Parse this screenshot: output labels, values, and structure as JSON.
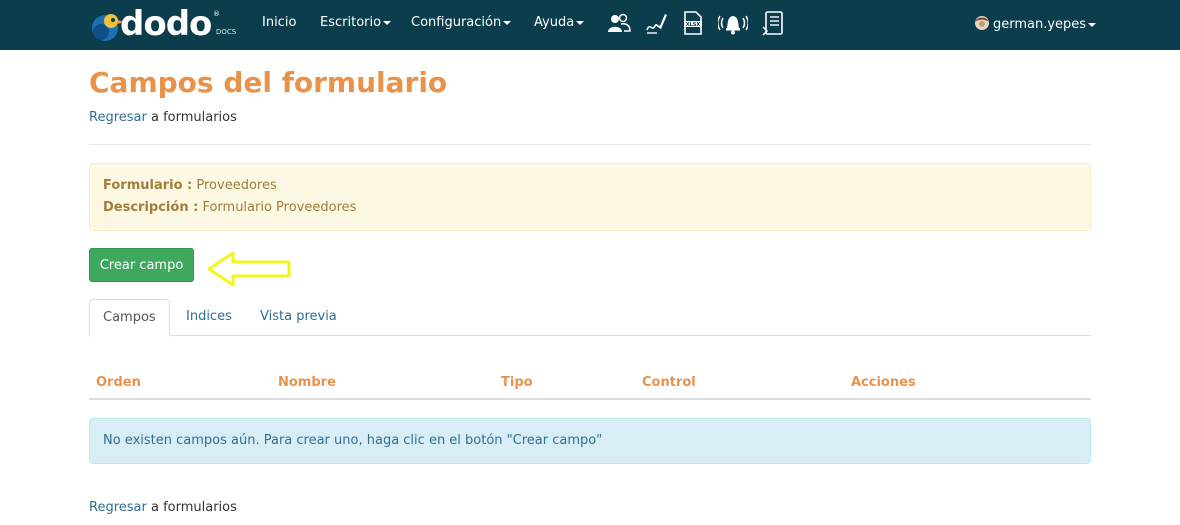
{
  "navbar": {
    "brand": "dodo",
    "brand_sub": "DOCS",
    "brand_reg": "®",
    "items": [
      {
        "label": "Inicio"
      },
      {
        "label": "Escritorio"
      },
      {
        "label": "Configuración"
      },
      {
        "label": "Ayuda"
      }
    ],
    "icons": [
      "users-icon",
      "signature-icon",
      "xlsx-file-icon",
      "alarm-bell-icon",
      "document-list-icon"
    ],
    "user": "german.yepes",
    "bg_color": "#0b3d4c"
  },
  "page": {
    "title": "Campos del formulario",
    "back_link": "Regresar",
    "back_suffix": " a formularios",
    "title_color": "#e8924a"
  },
  "info": {
    "form_label": "Formulario :",
    "form_value": " Proveedores",
    "desc_label": "Descripción :",
    "desc_value": " Formulario Proveedores"
  },
  "actions": {
    "create_label": "Crear campo",
    "create_color": "#3fa85f",
    "arrow_color": "#f5f51a"
  },
  "tabs": [
    {
      "label": "Campos",
      "active": true
    },
    {
      "label": "Indices",
      "active": false
    },
    {
      "label": "Vista previa",
      "active": false
    }
  ],
  "table": {
    "headers": [
      "Orden",
      "Nombre",
      "Tipo",
      "Control",
      "Acciones"
    ],
    "empty_message": "No existen campos aún. Para crear uno, haga clic en el botón \"Crear campo\""
  }
}
